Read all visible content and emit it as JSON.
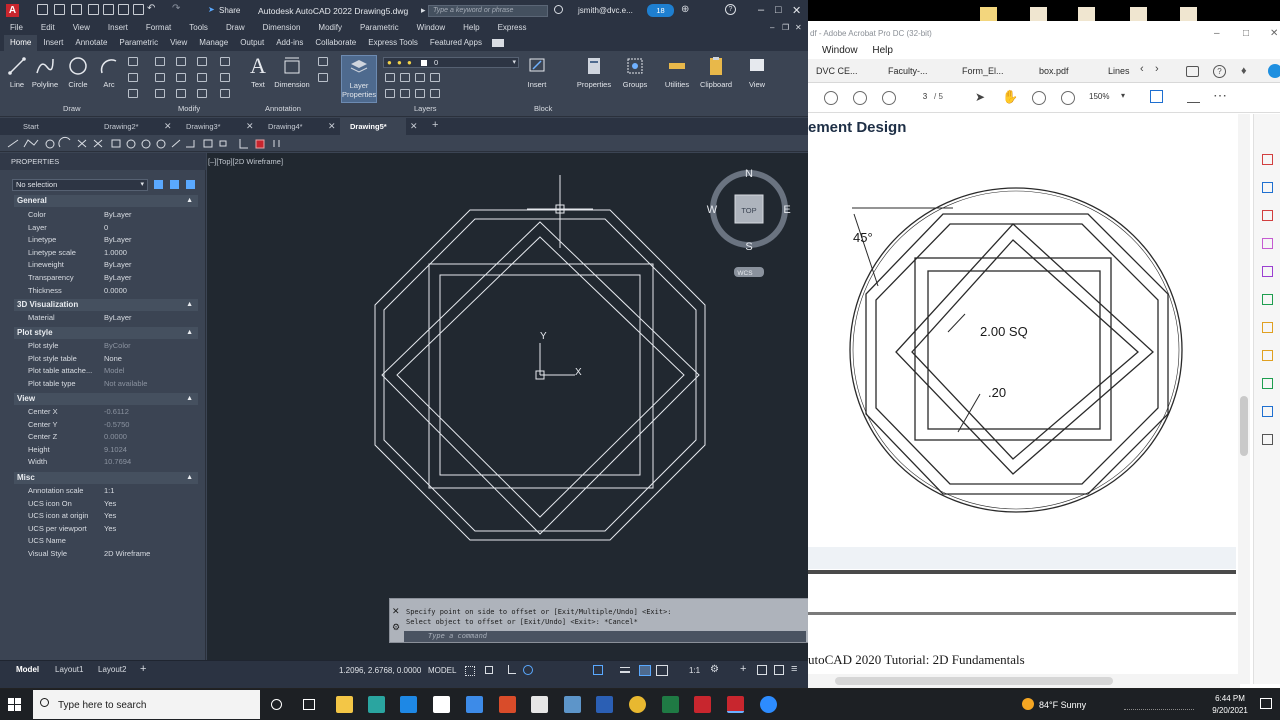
{
  "autocad": {
    "title": "Autodesk AutoCAD 2022    Drawing5.dwg",
    "share_label": "Share",
    "search_placeholder": "Type a keyword or phrase",
    "user": "jsmith@dvc.e...",
    "notifications": "18",
    "menubar": [
      "File",
      "Edit",
      "View",
      "Insert",
      "Format",
      "Tools",
      "Draw",
      "Dimension",
      "Modify",
      "Parametric",
      "Window",
      "Help",
      "Express"
    ],
    "ribbon_tabs": [
      "Home",
      "Insert",
      "Annotate",
      "Parametric",
      "View",
      "Manage",
      "Output",
      "Add-ins",
      "Collaborate",
      "Express Tools",
      "Featured Apps"
    ],
    "active_ribbon_tab": "Home",
    "ribbon_tools": {
      "line": "Line",
      "polyline": "Polyline",
      "circle": "Circle",
      "arc": "Arc",
      "text": "Text",
      "dimension": "Dimension",
      "layer_properties": "Layer\nProperties",
      "insert": "Insert",
      "properties": "Properties",
      "groups": "Groups",
      "utilities": "Utilities",
      "clipboard": "Clipboard",
      "view": "View"
    },
    "ribbon_groups": [
      "Draw",
      "Modify",
      "Annotation",
      "Layers",
      "Block"
    ],
    "layer_current": "0",
    "doc_tabs": [
      "Start",
      "Drawing2*",
      "Drawing3*",
      "Drawing4*",
      "Drawing5*"
    ],
    "active_doc": "Drawing5*",
    "properties": {
      "title": "PROPERTIES",
      "selection": "No selection",
      "sections": {
        "general": "General",
        "viz": "3D Visualization",
        "plot": "Plot style",
        "view": "View",
        "misc": "Misc"
      },
      "general": [
        {
          "k": "Color",
          "v": "ByLayer"
        },
        {
          "k": "Layer",
          "v": "0"
        },
        {
          "k": "Linetype",
          "v": "ByLayer"
        },
        {
          "k": "Linetype scale",
          "v": "1.0000"
        },
        {
          "k": "Lineweight",
          "v": "ByLayer"
        },
        {
          "k": "Transparency",
          "v": "ByLayer"
        },
        {
          "k": "Thickness",
          "v": "0.0000"
        }
      ],
      "viz": [
        {
          "k": "Material",
          "v": "ByLayer"
        }
      ],
      "plot": [
        {
          "k": "Plot style",
          "v": "ByColor"
        },
        {
          "k": "Plot style table",
          "v": "None"
        },
        {
          "k": "Plot table attache...",
          "v": "Model"
        },
        {
          "k": "Plot table type",
          "v": "Not available"
        }
      ],
      "view": [
        {
          "k": "Center X",
          "v": "-0.6112"
        },
        {
          "k": "Center Y",
          "v": "-0.5750"
        },
        {
          "k": "Center Z",
          "v": "0.0000"
        },
        {
          "k": "Height",
          "v": "9.1024"
        },
        {
          "k": "Width",
          "v": "10.7694"
        }
      ],
      "misc": [
        {
          "k": "Annotation scale",
          "v": "1:1"
        },
        {
          "k": "UCS icon On",
          "v": "Yes"
        },
        {
          "k": "UCS icon at origin",
          "v": "Yes"
        },
        {
          "k": "UCS per viewport",
          "v": "Yes"
        },
        {
          "k": "UCS Name",
          "v": ""
        },
        {
          "k": "Visual Style",
          "v": "2D Wireframe"
        }
      ]
    },
    "viewport_label": "[–][Top][2D Wireframe]",
    "viewcube": {
      "n": "N",
      "s": "S",
      "e": "E",
      "w": "W",
      "face": "TOP",
      "wcs": "WCS"
    },
    "ucs": {
      "x": "X",
      "y": "Y"
    },
    "command": {
      "line1": "Specify point on side to offset or [Exit/Multiple/Undo] <Exit>:",
      "line2": "Select object to offset or [Exit/Undo] <Exit>: *Cancel*",
      "placeholder": "Type a command"
    },
    "layout_tabs": [
      "Model",
      "Layout1",
      "Layout2"
    ],
    "status": {
      "coords": "1.2096, 2.6768, 0.0000",
      "model": "MODEL",
      "scale": "1:1"
    }
  },
  "acrobat": {
    "title": "df - Adobe Acrobat Pro DC (32-bit)",
    "menubar": [
      "Window",
      "Help"
    ],
    "tabs": [
      "DVC CE...",
      "Faculty-...",
      "Form_El...",
      "box.pdf",
      "Lines"
    ],
    "page_current": "3",
    "page_total": "/ 5",
    "zoom": "150%",
    "heading": "ement Design",
    "figure_labels": {
      "angle": "45°",
      "sq": "2.00 SQ",
      "thickness": ".20"
    },
    "footer": "utoCAD 2020 Tutorial: 2D Fundamentals"
  },
  "taskbar": {
    "search_placeholder": "Type here to search",
    "weather": "84°F  Sunny",
    "time": "6:44 PM",
    "date": "9/20/2021"
  }
}
